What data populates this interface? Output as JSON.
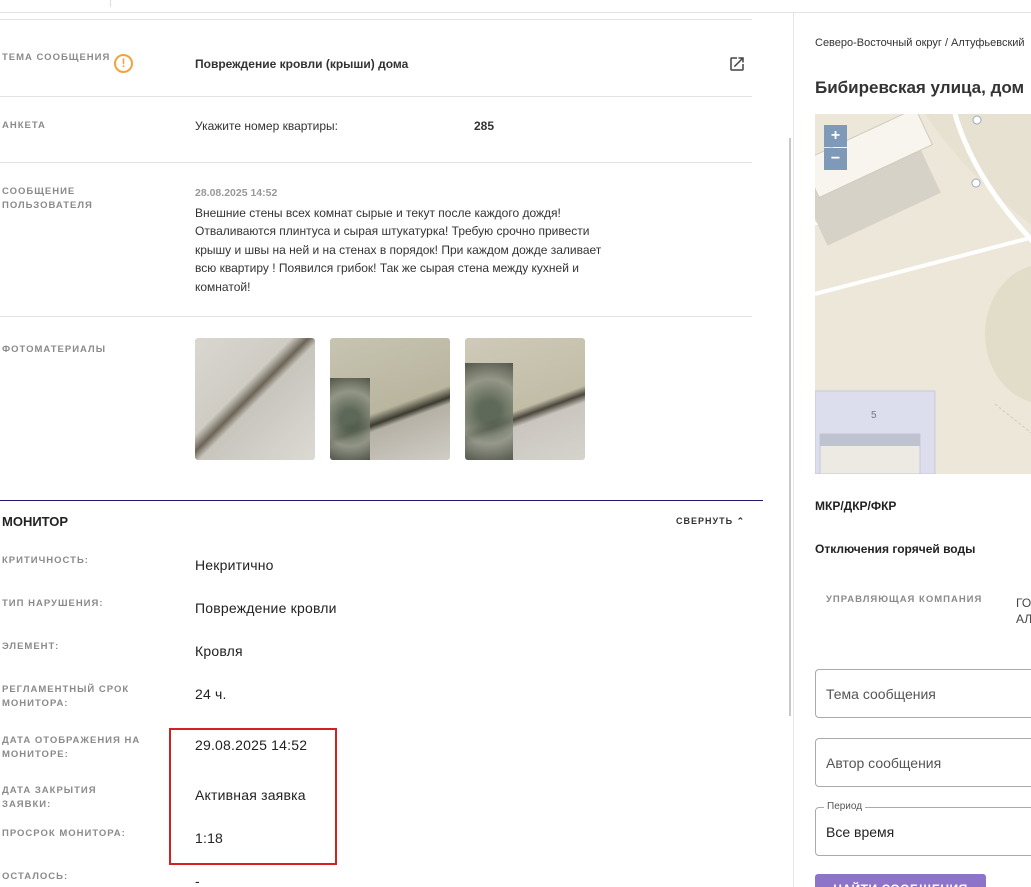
{
  "ticket": {
    "subject_label": "ТЕМА СООБЩЕНИЯ",
    "subject_value": "Повреждение кровли (крыши) дома",
    "survey_label": "АНКЕТА",
    "survey_question": "Укажите номер квартиры:",
    "survey_answer": "285",
    "message_label": "СООБЩЕНИЕ ПОЛЬЗОВАТЕЛЯ",
    "message_date": "28.08.2025 14:52",
    "message_text": "Внешние стены всех комнат сырые и текут после каждого дождя! Отваливаются плинтуса и сырая штукатурка! Требую срочно привести крышу и швы на ней и на стенах в порядок! При каждом дожде заливает всю квартиру ! Появился грибок! Так же сырая стена между кухней и комнатой!",
    "photos_label": "ФОТОМАТЕРИАЛЫ"
  },
  "monitor": {
    "title": "МОНИТОР",
    "collapse_label": "СВЕРНУТЬ",
    "rows": [
      {
        "label": "КРИТИЧНОСТЬ:",
        "value": "Некритично"
      },
      {
        "label": "ТИП НАРУШЕНИЯ:",
        "value": "Повреждение кровли"
      },
      {
        "label": "ЭЛЕМЕНТ:",
        "value": "Кровля"
      },
      {
        "label": "РЕГЛАМЕНТНЫЙ СРОК МОНИТОРА:",
        "value": "24 ч."
      },
      {
        "label": "ДАТА ОТОБРАЖЕНИЯ НА МОНИТОРЕ:",
        "value": "29.08.2025 14:52"
      },
      {
        "label": "ДАТА ЗАКРЫТИЯ ЗАЯВКИ:",
        "value": "Активная заявка"
      },
      {
        "label": "ПРОСРОК МОНИТОРА:",
        "value": "1:18"
      },
      {
        "label": "ОСТАЛОСЬ:",
        "value": "-"
      }
    ]
  },
  "right_panel": {
    "breadcrumb": "Северо-Восточный округ / Алтуфьевский",
    "address": "Бибиревская улица, дом",
    "map_house_number": "5",
    "zoom_in": "+",
    "zoom_out": "−",
    "mkr_label": "МКР/ДКР/ФКР",
    "hot_water_label": "Отключения горячей воды",
    "management_label": "УПРАВЛЯЮЩАЯ КОМПАНИЯ",
    "management_value": "ГО\nАЛ",
    "subject_placeholder": "Тема сообщения",
    "author_placeholder": "Автор сообщения",
    "period_label": "Период",
    "period_value": "Все время",
    "find_button": "НАЙТИ СООБЩЕНИЯ"
  },
  "colors": {
    "accent": "#8e74c9",
    "warning": "#f2a23c",
    "highlight_box": "#d32020",
    "monitor_divider": "#1f1a6e"
  }
}
